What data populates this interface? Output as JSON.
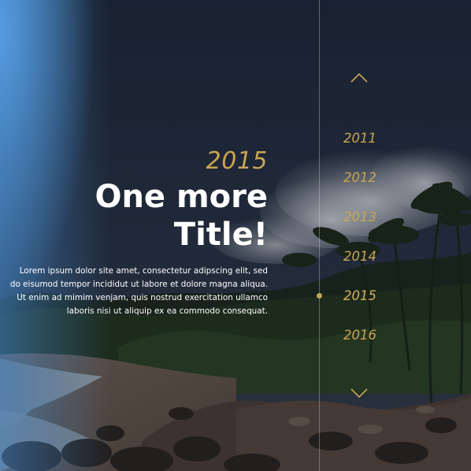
{
  "hero": {
    "year": "2015",
    "title": "One more\nTitle!",
    "description": "Lorem ipsum dolor site amet, consectetur adipscing elit, sed do eisumod tempor incididut ut labore et dolore magna aliqua. Ut enim ad mimim venjam, quis nostrud exercitation ullamco laboris nisi ut aliquip ex ea commodo consequat."
  },
  "timeline": {
    "prev_icon": "chevron-up-icon",
    "next_icon": "chevron-down-icon",
    "years": [
      {
        "label": "2011",
        "active": false
      },
      {
        "label": "2012",
        "active": false
      },
      {
        "label": "2013",
        "active": false
      },
      {
        "label": "2014",
        "active": false
      },
      {
        "label": "2015",
        "active": true
      },
      {
        "label": "2016",
        "active": false
      }
    ]
  },
  "colors": {
    "accent": "#c9a454",
    "title": "#ffffff",
    "line": "#d2d2d2"
  }
}
